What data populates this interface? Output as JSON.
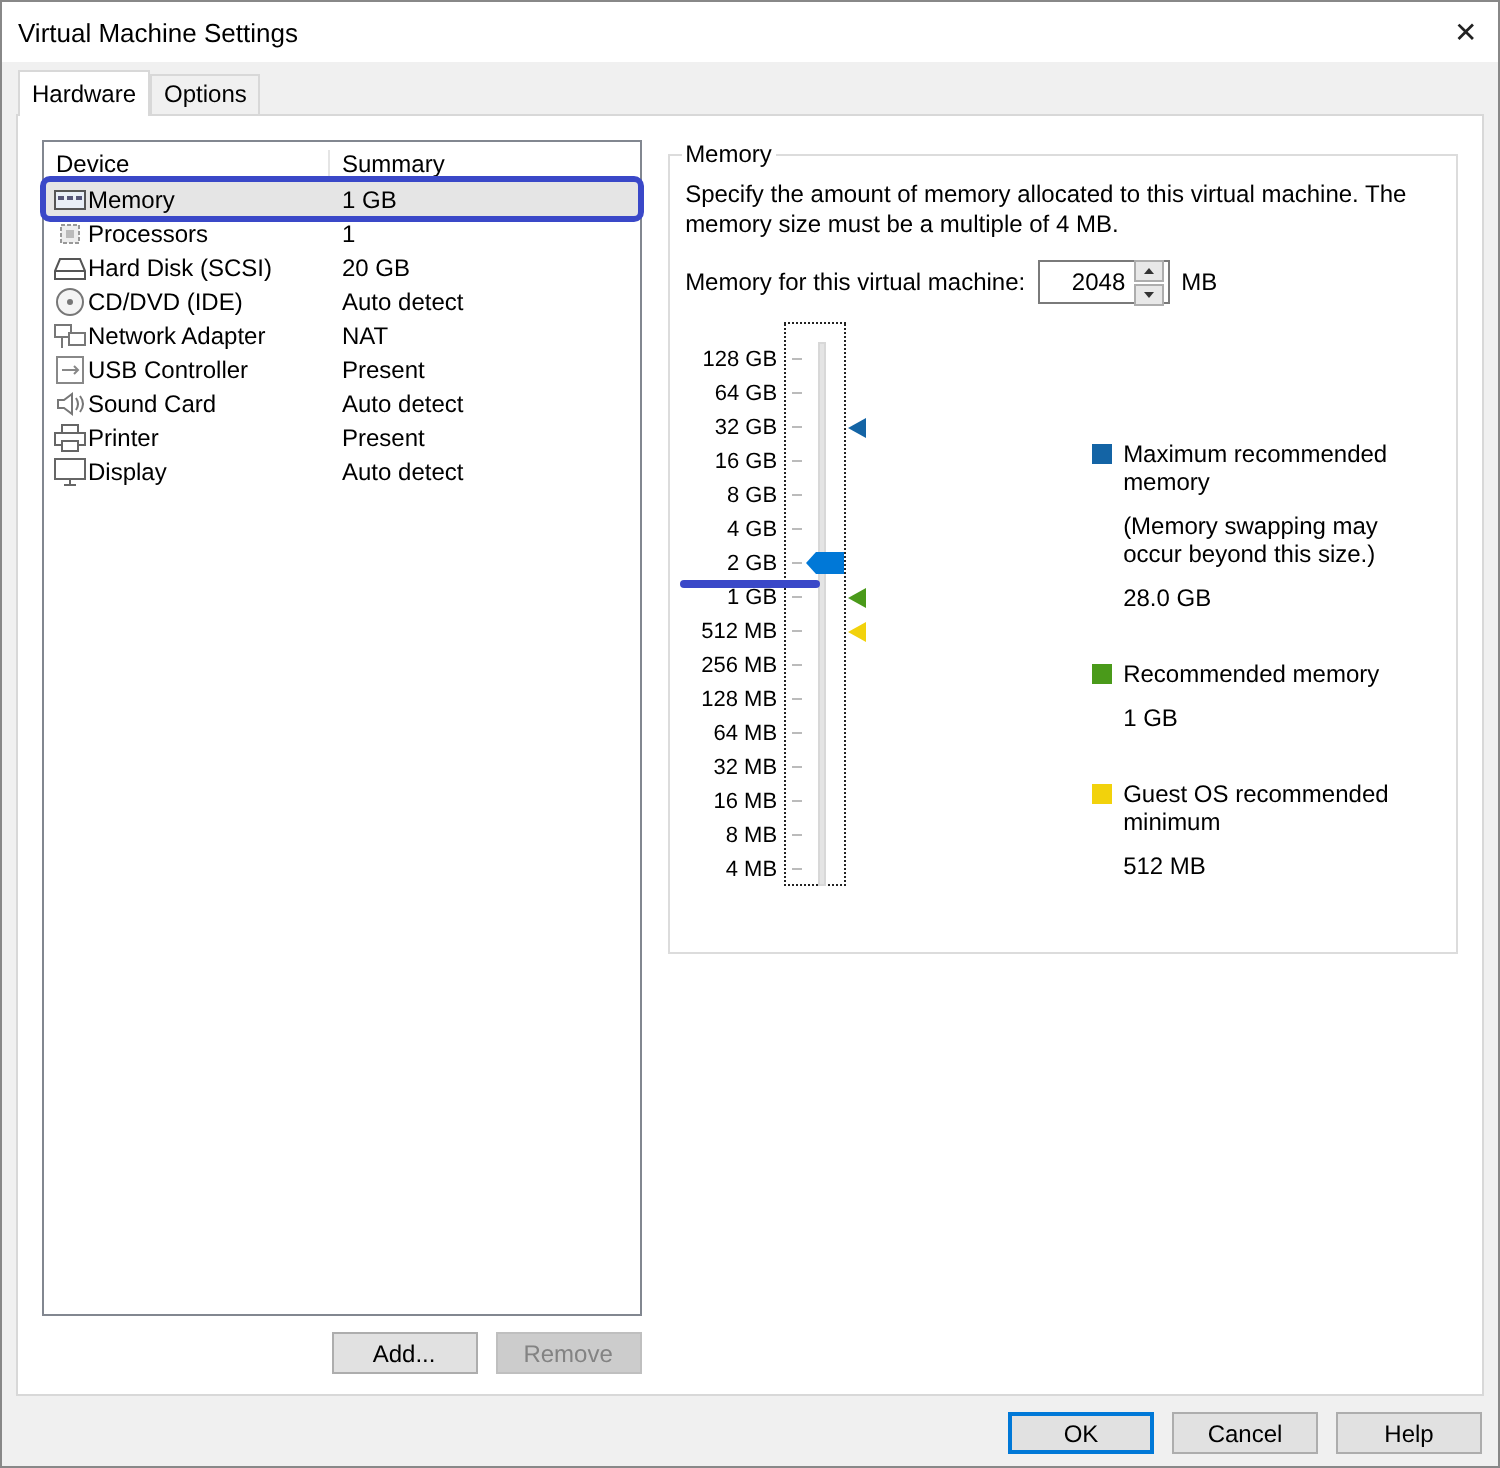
{
  "window": {
    "title": "Virtual Machine Settings",
    "close": "✕"
  },
  "tabs": [
    {
      "label": "Hardware",
      "selected": true
    },
    {
      "label": "Options",
      "selected": false
    }
  ],
  "devices": {
    "columns": [
      "Device",
      "Summary"
    ],
    "rows": [
      {
        "kind": "memory",
        "name": "Memory",
        "summary": "1 GB",
        "selected": true,
        "annotated": true
      },
      {
        "kind": "processor",
        "name": "Processors",
        "summary": "1",
        "selected": false,
        "annotated": false
      },
      {
        "kind": "disk",
        "name": "Hard Disk (SCSI)",
        "summary": "20 GB",
        "selected": false,
        "annotated": false
      },
      {
        "kind": "cdrom",
        "name": "CD/DVD (IDE)",
        "summary": "Auto detect",
        "selected": false,
        "annotated": false
      },
      {
        "kind": "network",
        "name": "Network Adapter",
        "summary": "NAT",
        "selected": false,
        "annotated": false
      },
      {
        "kind": "usb",
        "name": "USB Controller",
        "summary": "Present",
        "selected": false,
        "annotated": false
      },
      {
        "kind": "sound",
        "name": "Sound Card",
        "summary": "Auto detect",
        "selected": false,
        "annotated": false
      },
      {
        "kind": "printer",
        "name": "Printer",
        "summary": "Present",
        "selected": false,
        "annotated": false
      },
      {
        "kind": "display",
        "name": "Display",
        "summary": "Auto detect",
        "selected": false,
        "annotated": false
      }
    ]
  },
  "list_buttons": [
    {
      "label": "Add...",
      "disabled": false
    },
    {
      "label": "Remove",
      "disabled": true
    }
  ],
  "memory": {
    "legend": "Memory",
    "description": "Specify the amount of memory allocated to this virtual machine. The memory size must be a multiple of 4 MB.",
    "field_label": "Memory for this virtual machine:",
    "value": "2048",
    "unit": "MB",
    "slider": {
      "level": 0.6,
      "annotated": true,
      "ticks": [
        {
          "label": "128 GB"
        },
        {
          "label": "64 GB"
        },
        {
          "label": "32 GB",
          "color": "#1464a5"
        },
        {
          "label": "16 GB"
        },
        {
          "label": "8 GB"
        },
        {
          "label": "4 GB"
        },
        {
          "label": "2 GB"
        },
        {
          "label": "1 GB",
          "color": "#4a9a1a"
        },
        {
          "label": "512 MB",
          "color": "#f2d20c"
        },
        {
          "label": "256 MB"
        },
        {
          "label": "128 MB"
        },
        {
          "label": "64 MB"
        },
        {
          "label": "32 MB"
        },
        {
          "label": "16 MB"
        },
        {
          "label": "8 MB"
        },
        {
          "label": "4 MB"
        }
      ]
    },
    "legend_items": [
      {
        "color": "#1464a5",
        "title": "Maximum recommended memory",
        "note": "(Memory swapping may occur beyond this size.)",
        "value": "28.0 GB"
      },
      {
        "color": "#4a9a1a",
        "title": "Recommended memory",
        "value": "1 GB"
      },
      {
        "color": "#f2d20c",
        "title": "Guest OS recommended minimum",
        "value": "512 MB"
      }
    ]
  },
  "dialog_buttons": [
    {
      "label": "OK",
      "default": true
    },
    {
      "label": "Cancel",
      "default": false
    },
    {
      "label": "Help",
      "default": false
    }
  ]
}
